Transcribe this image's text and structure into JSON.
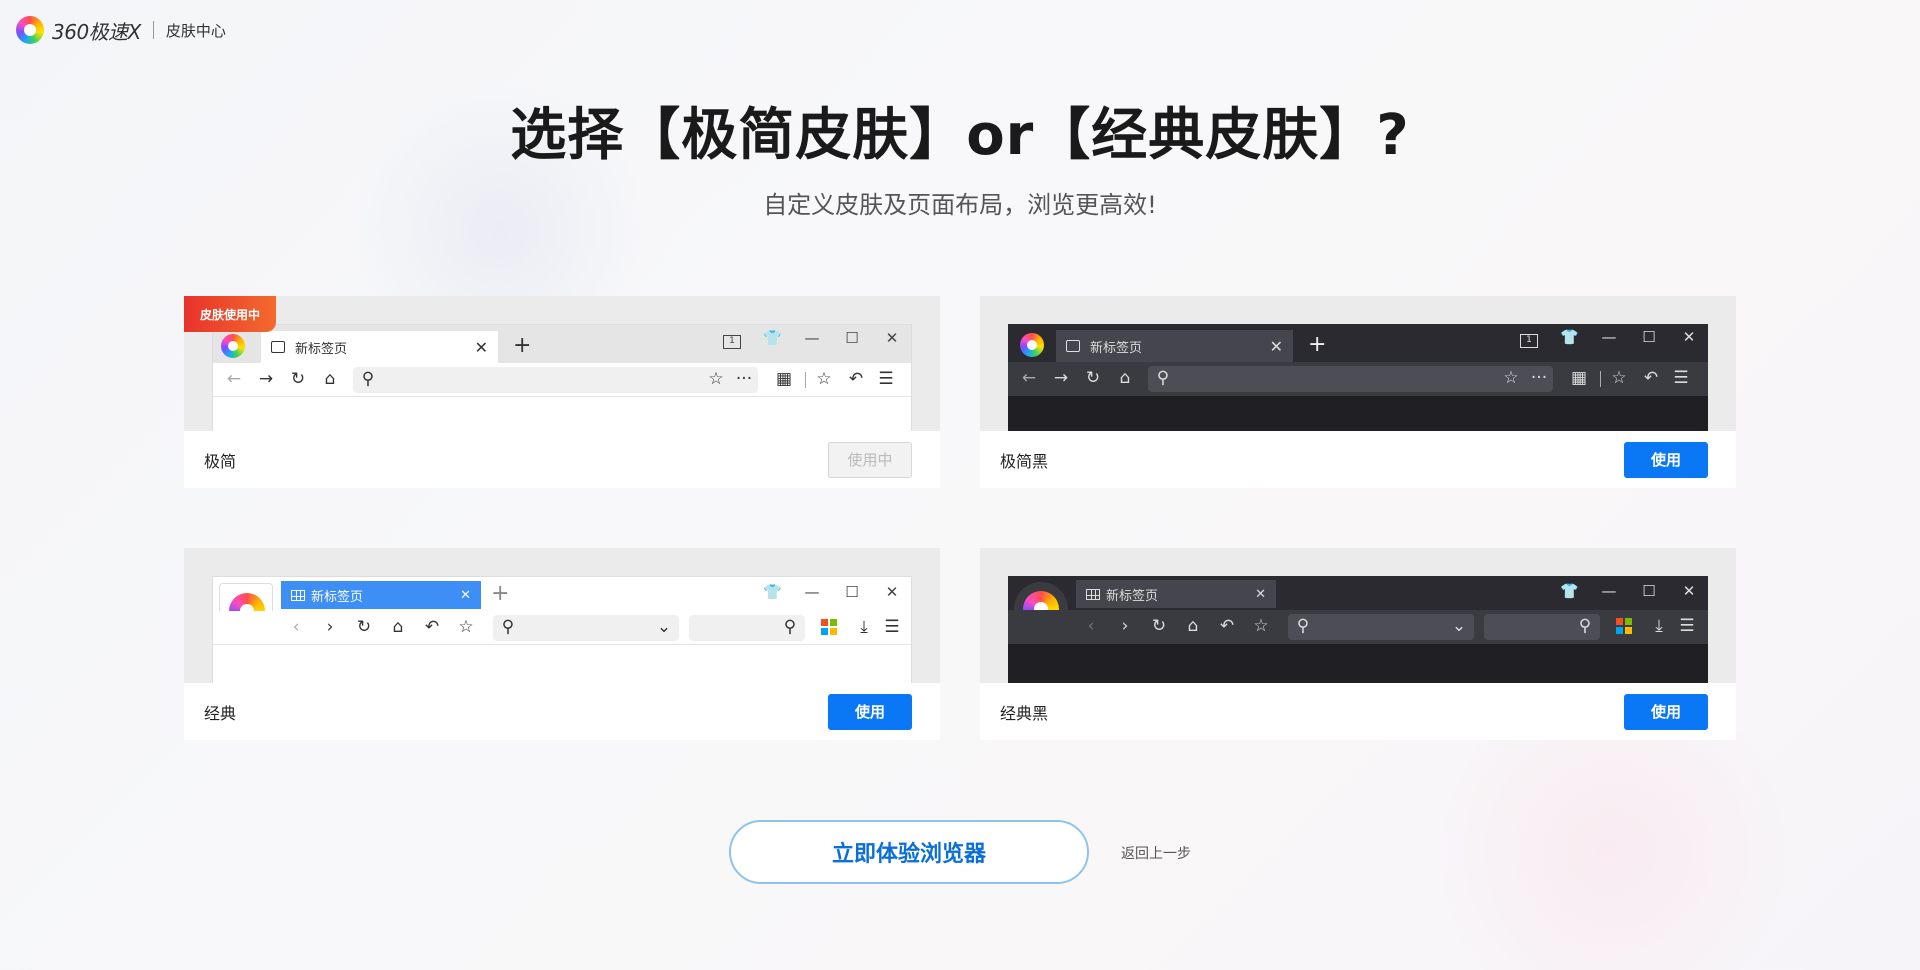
{
  "header": {
    "brand": "360极速X",
    "section": "皮肤中心"
  },
  "hero": {
    "title": "选择【极简皮肤】or【经典皮肤】?",
    "subtitle": "自定义皮肤及页面布局，浏览更高效!"
  },
  "skins": [
    {
      "name": "极简",
      "button": "使用中",
      "badge": "皮肤使用中",
      "tab_label": "新标签页",
      "theme": "light",
      "in_use": true
    },
    {
      "name": "极简黑",
      "button": "使用",
      "tab_label": "新标签页",
      "theme": "dark",
      "in_use": false
    },
    {
      "name": "经典",
      "button": "使用",
      "tab_label": "新标签页",
      "theme": "light",
      "in_use": false
    },
    {
      "name": "经典黑",
      "button": "使用",
      "tab_label": "新标签页",
      "theme": "dark",
      "in_use": false
    }
  ],
  "footer": {
    "cta": "立即体验浏览器",
    "back": "返回上一步"
  },
  "colors": {
    "primary": "#0a78f5",
    "badge": "#e8332c",
    "dark_chrome": "#1f1f24"
  }
}
